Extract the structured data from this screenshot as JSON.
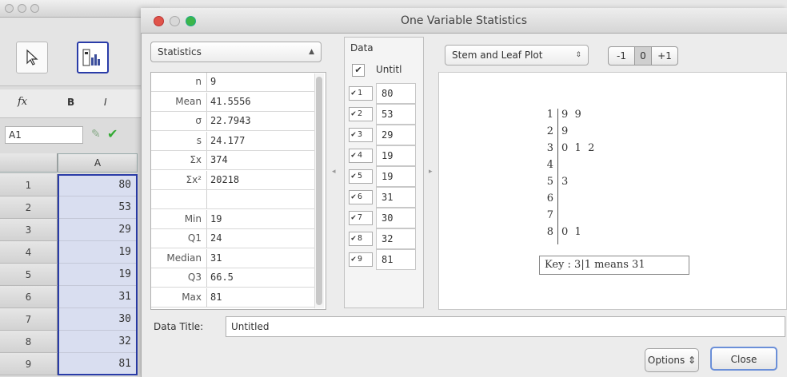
{
  "spreadsheet": {
    "cell_ref": "A1",
    "column_header": "A",
    "rows": [
      {
        "num": "1",
        "value": "80"
      },
      {
        "num": "2",
        "value": "53"
      },
      {
        "num": "3",
        "value": "29"
      },
      {
        "num": "4",
        "value": "19"
      },
      {
        "num": "5",
        "value": "19"
      },
      {
        "num": "6",
        "value": "31"
      },
      {
        "num": "7",
        "value": "30"
      },
      {
        "num": "8",
        "value": "32"
      },
      {
        "num": "9",
        "value": "81"
      }
    ],
    "format_bold": "B",
    "format_italic": "I",
    "fx": "fx"
  },
  "dialog": {
    "title": "One Variable Statistics",
    "stats_select": "Statistics",
    "stats": [
      {
        "label": "n",
        "value": "9"
      },
      {
        "label": "Mean",
        "value": "41.5556"
      },
      {
        "label": "σ",
        "value": "22.7943"
      },
      {
        "label": "s",
        "value": "24.177"
      },
      {
        "label": "Σx",
        "value": "374"
      },
      {
        "label": "Σx²",
        "value": "20218"
      },
      {
        "label": "",
        "value": ""
      },
      {
        "label": "Min",
        "value": "19"
      },
      {
        "label": "Q1",
        "value": "24"
      },
      {
        "label": "Median",
        "value": "31"
      },
      {
        "label": "Q3",
        "value": "66.5"
      },
      {
        "label": "Max",
        "value": "81"
      }
    ],
    "data_header": "Data",
    "data_column_label": "Untitl",
    "data_rows": [
      {
        "idx": "1",
        "value": "80"
      },
      {
        "idx": "2",
        "value": "53"
      },
      {
        "idx": "3",
        "value": "29"
      },
      {
        "idx": "4",
        "value": "19"
      },
      {
        "idx": "5",
        "value": "19"
      },
      {
        "idx": "6",
        "value": "31"
      },
      {
        "idx": "7",
        "value": "30"
      },
      {
        "idx": "8",
        "value": "32"
      },
      {
        "idx": "9",
        "value": "81"
      }
    ],
    "plot_select": "Stem and Leaf Plot",
    "adjust_minus": "-1",
    "adjust_zero": "0",
    "adjust_plus": "+1",
    "stem_plot": [
      {
        "stem": "1",
        "leaves": "9  9"
      },
      {
        "stem": "2",
        "leaves": "9"
      },
      {
        "stem": "3",
        "leaves": "0  1  2"
      },
      {
        "stem": "4",
        "leaves": ""
      },
      {
        "stem": "5",
        "leaves": "3"
      },
      {
        "stem": "6",
        "leaves": ""
      },
      {
        "stem": "7",
        "leaves": ""
      },
      {
        "stem": "8",
        "leaves": "0  1"
      }
    ],
    "key": "Key : 3|1 means 31",
    "data_title_label": "Data Title:",
    "data_title_value": "Untitled",
    "options_button": "Options ⇕",
    "close_button": "Close"
  }
}
